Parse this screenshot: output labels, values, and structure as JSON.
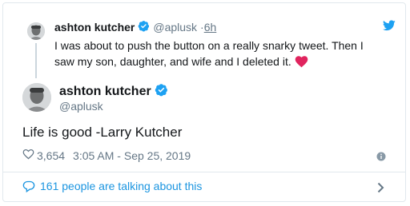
{
  "parent_tweet": {
    "name": "ashton kutcher",
    "handle": "@aplusk",
    "separator": "·",
    "time": "6h",
    "text": "I was about to push the button on a really snarky tweet. Then I saw my son, daughter, and wife and I deleted it."
  },
  "main_tweet": {
    "name": "ashton kutcher",
    "handle": "@aplusk",
    "text": "Life is good -Larry Kutcher",
    "like_count": "3,654",
    "timestamp": "3:05 AM - Sep 25, 2019"
  },
  "footer": {
    "talking_text": "161 people are talking about this"
  },
  "colors": {
    "verified_blue": "#1da1f2",
    "link_blue": "#1b95e0",
    "heart_red": "#e0245e",
    "muted_gray": "#657786"
  }
}
